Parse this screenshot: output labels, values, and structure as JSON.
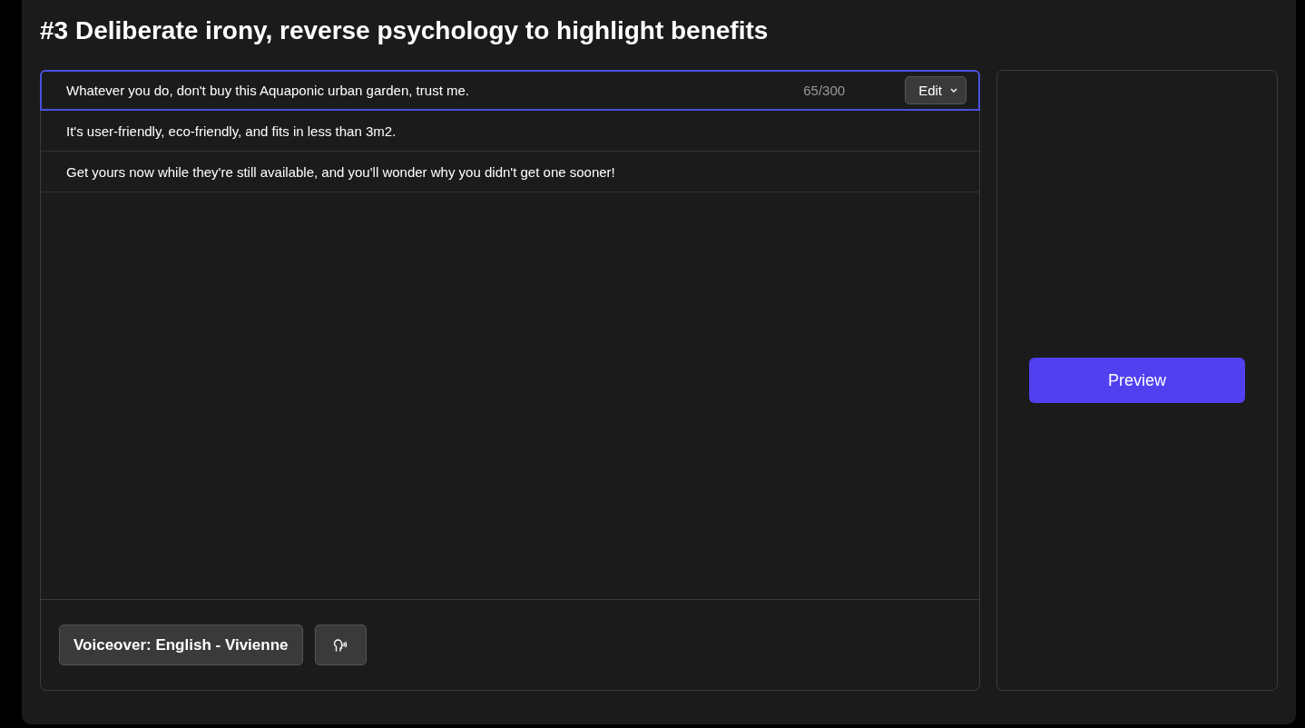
{
  "title": "#3 Deliberate irony, reverse psychology to highlight benefits",
  "lines": [
    {
      "text": "Whatever you do, don't buy this Aquaponic urban garden, trust me.",
      "selected": true,
      "count": "65/300",
      "edit_label": "Edit"
    },
    {
      "text": "It's user-friendly, eco-friendly, and fits in less than 3m2.",
      "selected": false
    },
    {
      "text": "Get yours now while they're still available, and you'll wonder why you didn't get one sooner!",
      "selected": false
    }
  ],
  "voiceover": {
    "label": "Voiceover: English - Vivienne"
  },
  "preview": {
    "label": "Preview"
  }
}
